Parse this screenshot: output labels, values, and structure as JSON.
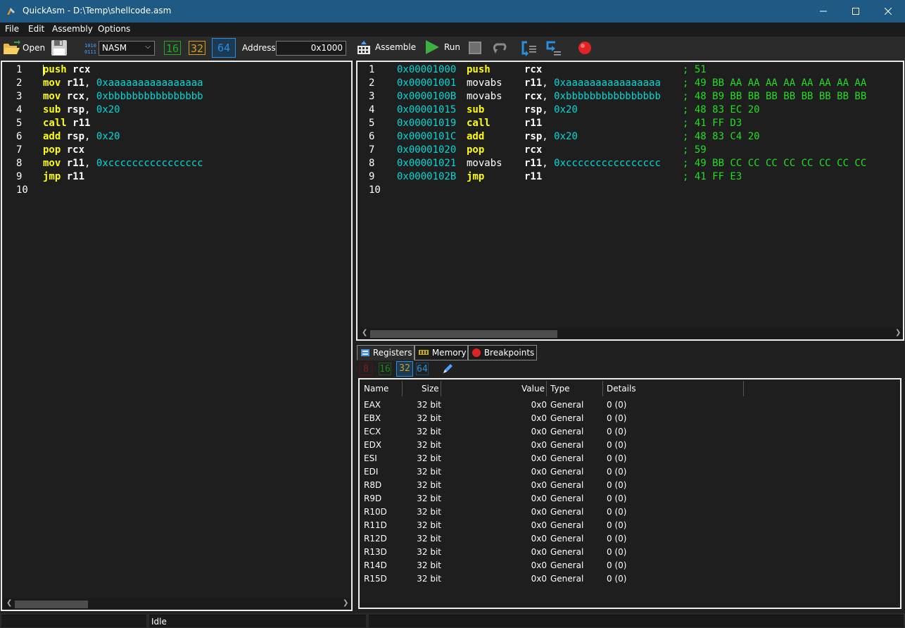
{
  "window": {
    "title": "QuickAsm - D:\\Temp\\shellcode.asm"
  },
  "menu": [
    "File",
    "Edit",
    "Assembly",
    "Options"
  ],
  "toolbar": {
    "open_label": "Open",
    "syntax_value": "NASM",
    "bits": [
      "16",
      "32",
      "64"
    ],
    "address_label": "Address:",
    "address_value": "0x1000",
    "assemble_label": "Assemble",
    "run_label": "Run"
  },
  "editor": {
    "lines": [
      {
        "n": "1",
        "m": "push",
        "a": [
          {
            "t": "rcx",
            "k": "reg"
          }
        ]
      },
      {
        "n": "2",
        "m": "mov",
        "a": [
          {
            "t": "r11",
            "k": "reg"
          },
          {
            "t": ", ",
            "k": "p"
          },
          {
            "t": "0xaaaaaaaaaaaaaaaa",
            "k": "num"
          }
        ]
      },
      {
        "n": "3",
        "m": "mov",
        "a": [
          {
            "t": "rcx",
            "k": "reg"
          },
          {
            "t": ", ",
            "k": "p"
          },
          {
            "t": "0xbbbbbbbbbbbbbbbb",
            "k": "num"
          }
        ]
      },
      {
        "n": "4",
        "m": "sub",
        "a": [
          {
            "t": "rsp",
            "k": "reg"
          },
          {
            "t": ", ",
            "k": "p"
          },
          {
            "t": "0x20",
            "k": "num"
          }
        ]
      },
      {
        "n": "5",
        "m": "call",
        "a": [
          {
            "t": "r11",
            "k": "reg"
          }
        ]
      },
      {
        "n": "6",
        "m": "add",
        "a": [
          {
            "t": "rsp",
            "k": "reg"
          },
          {
            "t": ", ",
            "k": "p"
          },
          {
            "t": "0x20",
            "k": "num"
          }
        ]
      },
      {
        "n": "7",
        "m": "pop",
        "a": [
          {
            "t": "rcx",
            "k": "reg"
          }
        ]
      },
      {
        "n": "8",
        "m": "mov",
        "a": [
          {
            "t": "r11",
            "k": "reg"
          },
          {
            "t": ", ",
            "k": "p"
          },
          {
            "t": "0xcccccccccccccccc",
            "k": "num"
          }
        ]
      },
      {
        "n": "9",
        "m": "jmp",
        "a": [
          {
            "t": "r11",
            "k": "reg"
          }
        ]
      },
      {
        "n": "10",
        "m": "",
        "a": []
      }
    ]
  },
  "disasm": {
    "lines": [
      {
        "n": "1",
        "addr": "0x00001000",
        "m": "push",
        "mk": "kw",
        "a": [
          {
            "t": "rcx",
            "k": "reg"
          }
        ],
        "c": "; 51"
      },
      {
        "n": "2",
        "addr": "0x00001001",
        "m": "movabs",
        "mk": "mnem",
        "a": [
          {
            "t": "r11",
            "k": "reg"
          },
          {
            "t": ", ",
            "k": "p"
          },
          {
            "t": "0xaaaaaaaaaaaaaaaa",
            "k": "num"
          }
        ],
        "c": "; 49 BB AA AA AA AA AA AA AA AA"
      },
      {
        "n": "3",
        "addr": "0x0000100B",
        "m": "movabs",
        "mk": "mnem",
        "a": [
          {
            "t": "rcx",
            "k": "reg"
          },
          {
            "t": ", ",
            "k": "p"
          },
          {
            "t": "0xbbbbbbbbbbbbbbbb",
            "k": "num"
          }
        ],
        "c": "; 48 B9 BB BB BB BB BB BB BB BB"
      },
      {
        "n": "4",
        "addr": "0x00001015",
        "m": "sub",
        "mk": "kw",
        "a": [
          {
            "t": "rsp",
            "k": "reg"
          },
          {
            "t": ", ",
            "k": "p"
          },
          {
            "t": "0x20",
            "k": "num"
          }
        ],
        "c": "; 48 83 EC 20"
      },
      {
        "n": "5",
        "addr": "0x00001019",
        "m": "call",
        "mk": "kw",
        "a": [
          {
            "t": "r11",
            "k": "reg"
          }
        ],
        "c": "; 41 FF D3"
      },
      {
        "n": "6",
        "addr": "0x0000101C",
        "m": "add",
        "mk": "kw",
        "a": [
          {
            "t": "rsp",
            "k": "reg"
          },
          {
            "t": ", ",
            "k": "p"
          },
          {
            "t": "0x20",
            "k": "num"
          }
        ],
        "c": "; 48 83 C4 20"
      },
      {
        "n": "7",
        "addr": "0x00001020",
        "m": "pop",
        "mk": "kw",
        "a": [
          {
            "t": "rcx",
            "k": "reg"
          }
        ],
        "c": "; 59"
      },
      {
        "n": "8",
        "addr": "0x00001021",
        "m": "movabs",
        "mk": "mnem",
        "a": [
          {
            "t": "r11",
            "k": "reg"
          },
          {
            "t": ", ",
            "k": "p"
          },
          {
            "t": "0xcccccccccccccccc",
            "k": "num"
          }
        ],
        "c": "; 49 BB CC CC CC CC CC CC CC CC"
      },
      {
        "n": "9",
        "addr": "0x0000102B",
        "m": "jmp",
        "mk": "kw",
        "a": [
          {
            "t": "r11",
            "k": "reg"
          }
        ],
        "c": "; 41 FF E3"
      },
      {
        "n": "10",
        "addr": "",
        "m": "",
        "mk": "kw",
        "a": [],
        "c": ""
      }
    ]
  },
  "tabs": [
    "Registers",
    "Memory",
    "Breakpoints"
  ],
  "reg_bits": [
    "8",
    "16",
    "32",
    "64"
  ],
  "registers": {
    "columns": [
      "Name",
      "Size",
      "Value",
      "Type",
      "Details"
    ],
    "rows": [
      [
        "EAX",
        "32 bit",
        "0x0",
        "General",
        "0 (0)"
      ],
      [
        "EBX",
        "32 bit",
        "0x0",
        "General",
        "0 (0)"
      ],
      [
        "ECX",
        "32 bit",
        "0x0",
        "General",
        "0 (0)"
      ],
      [
        "EDX",
        "32 bit",
        "0x0",
        "General",
        "0 (0)"
      ],
      [
        "ESI",
        "32 bit",
        "0x0",
        "General",
        "0 (0)"
      ],
      [
        "EDI",
        "32 bit",
        "0x0",
        "General",
        "0 (0)"
      ],
      [
        "R8D",
        "32 bit",
        "0x0",
        "General",
        "0 (0)"
      ],
      [
        "R9D",
        "32 bit",
        "0x0",
        "General",
        "0 (0)"
      ],
      [
        "R10D",
        "32 bit",
        "0x0",
        "General",
        "0 (0)"
      ],
      [
        "R11D",
        "32 bit",
        "0x0",
        "General",
        "0 (0)"
      ],
      [
        "R12D",
        "32 bit",
        "0x0",
        "General",
        "0 (0)"
      ],
      [
        "R13D",
        "32 bit",
        "0x0",
        "General",
        "0 (0)"
      ],
      [
        "R14D",
        "32 bit",
        "0x0",
        "General",
        "0 (0)"
      ],
      [
        "R15D",
        "32 bit",
        "0x0",
        "General",
        "0 (0)"
      ]
    ]
  },
  "status": {
    "text": "Idle"
  },
  "colors": {
    "titlebar": "#1f5a85",
    "keyword": "#ffff00",
    "number": "#00d8d8",
    "comment": "#22dd22",
    "bits16": "#22aa22",
    "bits32": "#d4a017",
    "bits64": "#2a8fdc",
    "bits8": "#b02020"
  }
}
